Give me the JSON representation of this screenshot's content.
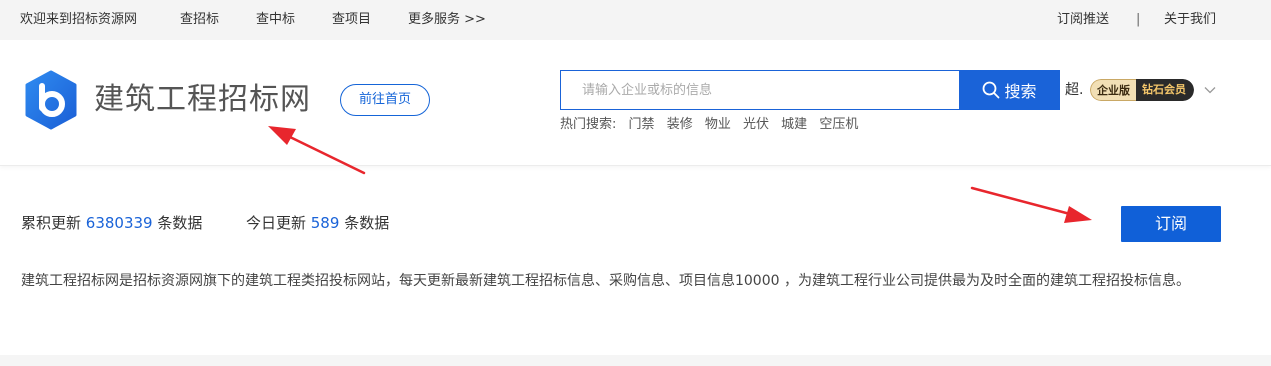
{
  "topbar": {
    "welcome": "欢迎来到招标资源网",
    "nav": [
      "查招标",
      "查中标",
      "查项目",
      "更多服务 >>"
    ],
    "subscribe_push": "订阅推送",
    "separator": "|",
    "about": "关于我们"
  },
  "header": {
    "logo_icon": "b-logo-icon",
    "site_name": "建筑工程招标网",
    "home_button": "前往首页",
    "search": {
      "placeholder": "请输入企业或标的信息",
      "value": "",
      "button_label": "搜索",
      "button_icon": "search-icon"
    },
    "hot_search": {
      "label": "热门搜索:",
      "keywords": [
        "门禁",
        "装修",
        "物业",
        "光伏",
        "城建",
        "空压机"
      ]
    },
    "user": {
      "name": "超.",
      "badge_left": "企业版",
      "badge_right": "钻石会员"
    }
  },
  "stats": {
    "total_label": "累积更新",
    "total_value": "6380339",
    "total_unit": "条数据",
    "today_label": "今日更新",
    "today_value": "589",
    "today_unit": "条数据"
  },
  "subscribe_button": "订阅",
  "description": "建筑工程招标网是招标资源网旗下的建筑工程类招投标网站，每天更新最新建筑工程招标信息、采购信息、项目信息10000 ，为建筑工程行业公司提供最为及时全面的建筑工程招投标信息。",
  "colors": {
    "primary": "#1a63d8",
    "topbar_bg": "#f4f4f4",
    "annotation_arrow": "#e8262d"
  }
}
